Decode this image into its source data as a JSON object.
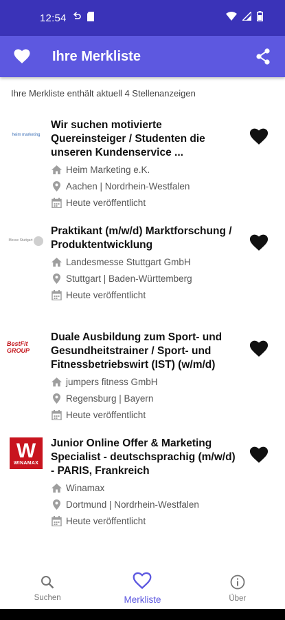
{
  "status_bar": {
    "time": "12:54"
  },
  "app_bar": {
    "title": "Ihre Merkliste",
    "leading_icon": "heart-icon",
    "action_icon": "share-icon"
  },
  "summary": "Ihre Merkliste enthält aktuell 4 Stellenanzeigen",
  "listings": [
    {
      "logo_text": "heim marketing",
      "title": "Wir suchen motivierte Quereinsteiger / Studenten die unseren Kundenservice ...",
      "company": "Heim Marketing e.K.",
      "location": "Aachen | Nordrhein-Westfalen",
      "published": "Heute veröffentlicht"
    },
    {
      "logo_text": "Messe Stuttgart",
      "title": "Praktikant (m/w/d) Marktforschung / Produktentwicklung",
      "company": "Landesmesse Stuttgart GmbH",
      "location": "Stuttgart | Baden-Württemberg",
      "published": "Heute veröffentlicht"
    },
    {
      "logo_text": "BestFit GROUP",
      "title": "Duale Ausbildung zum Sport- und Gesundheitstrainer / Sport- und Fitnessbetriebswirt (IST) (w/m/d)",
      "company": "jumpers fitness GmbH",
      "location": "Regensburg | Bayern",
      "published": "Heute veröffentlicht"
    },
    {
      "logo_text": "WINAMAX",
      "title": "Junior Online Offer & Marketing Specialist - deutschsprachig (m/w/d) - PARIS, Frankreich",
      "company": "Winamax",
      "location": "Dortmund | Nordrhein-Westfalen",
      "published": "Heute veröffentlicht"
    }
  ],
  "bottom_nav": {
    "items": [
      {
        "label": "Suchen",
        "icon": "search-icon",
        "active": false
      },
      {
        "label": "Merkliste",
        "icon": "heart-outline-icon",
        "active": true
      },
      {
        "label": "Über",
        "icon": "info-icon",
        "active": false
      }
    ]
  },
  "colors": {
    "status_bar": "#3a33b8",
    "app_bar": "#5d58e0",
    "accent": "#5d58e0"
  }
}
